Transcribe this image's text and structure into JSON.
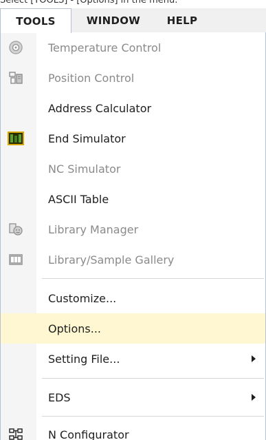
{
  "caption": "Select [TOOLS] - [Options] in the menu.",
  "menubar": {
    "tools": "TOOLS",
    "window": "WINDOW",
    "help": "HELP"
  },
  "menu": {
    "items": [
      {
        "label": "Temperature Control",
        "icon": "temperature-icon",
        "disabled": true
      },
      {
        "label": "Position Control",
        "icon": "position-icon",
        "disabled": true
      },
      {
        "label": "Address Calculator",
        "icon": "",
        "disabled": false
      },
      {
        "label": "End Simulator",
        "icon": "simulator-icon",
        "disabled": false
      },
      {
        "label": "NC Simulator",
        "icon": "",
        "disabled": true
      },
      {
        "label": "ASCII Table",
        "icon": "",
        "disabled": false
      },
      {
        "label": "Library Manager",
        "icon": "library-icon",
        "disabled": true
      },
      {
        "label": "Library/Sample Gallery",
        "icon": "gallery-icon",
        "disabled": true
      },
      {
        "label": "Customize...",
        "icon": "",
        "disabled": false
      },
      {
        "label": "Options...",
        "icon": "",
        "disabled": false,
        "highlight": true
      },
      {
        "label": "Setting File...",
        "icon": "",
        "disabled": false,
        "submenu": true
      },
      {
        "label": "EDS",
        "icon": "",
        "disabled": false,
        "submenu": true
      },
      {
        "label": "N Configurator",
        "icon": "network-icon",
        "disabled": false
      }
    ],
    "colors": {
      "highlight": "#fff7d1",
      "disabled_text": "#8a8a8a",
      "text": "#1e1e1e"
    }
  }
}
